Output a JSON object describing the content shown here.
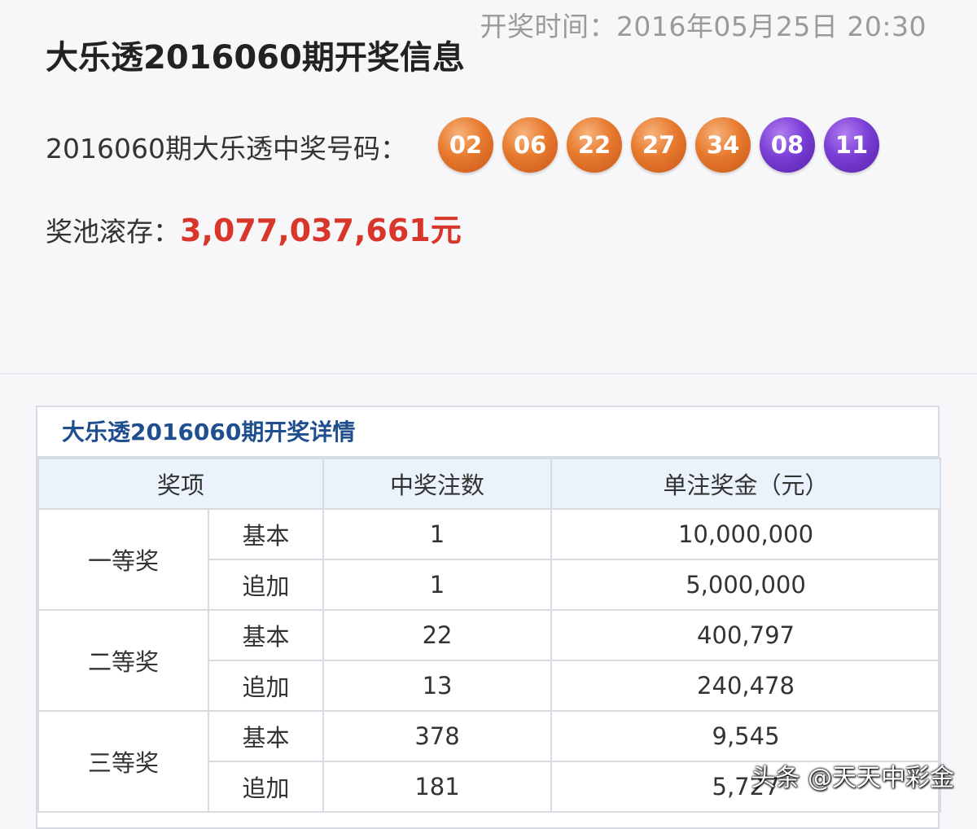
{
  "header": {
    "draw_time": "开奖时间：2016年05月25日 20:30",
    "title": "大乐透2016060期开奖信息",
    "numbers_label": "2016060期大乐透中奖号码：",
    "front_balls": [
      "02",
      "06",
      "22",
      "27",
      "34"
    ],
    "back_balls": [
      "08",
      "11"
    ],
    "pool_label": "奖池滚存：",
    "pool_amount": "3,077,037,661元"
  },
  "detail": {
    "title": "大乐透2016060期开奖详情",
    "columns": [
      "奖项",
      "中奖注数",
      "单注奖金（元）"
    ],
    "tiers": [
      {
        "name": "一等奖",
        "rows": [
          {
            "type": "基本",
            "count": "1",
            "prize": "10,000,000"
          },
          {
            "type": "追加",
            "count": "1",
            "prize": "5,000,000"
          }
        ]
      },
      {
        "name": "二等奖",
        "rows": [
          {
            "type": "基本",
            "count": "22",
            "prize": "400,797"
          },
          {
            "type": "追加",
            "count": "13",
            "prize": "240,478"
          }
        ]
      },
      {
        "name": "三等奖",
        "rows": [
          {
            "type": "基本",
            "count": "378",
            "prize": "9,545"
          },
          {
            "type": "追加",
            "count": "181",
            "prize": "5,727"
          }
        ]
      }
    ]
  },
  "watermark": "头条 @天天中彩金",
  "colors": {
    "front_ball": "#e77a2e",
    "back_ball": "#7a3fd6",
    "pool_amount": "#d8362a",
    "detail_title": "#1f4f8f",
    "table_header_bg": "#eaf3fc"
  }
}
